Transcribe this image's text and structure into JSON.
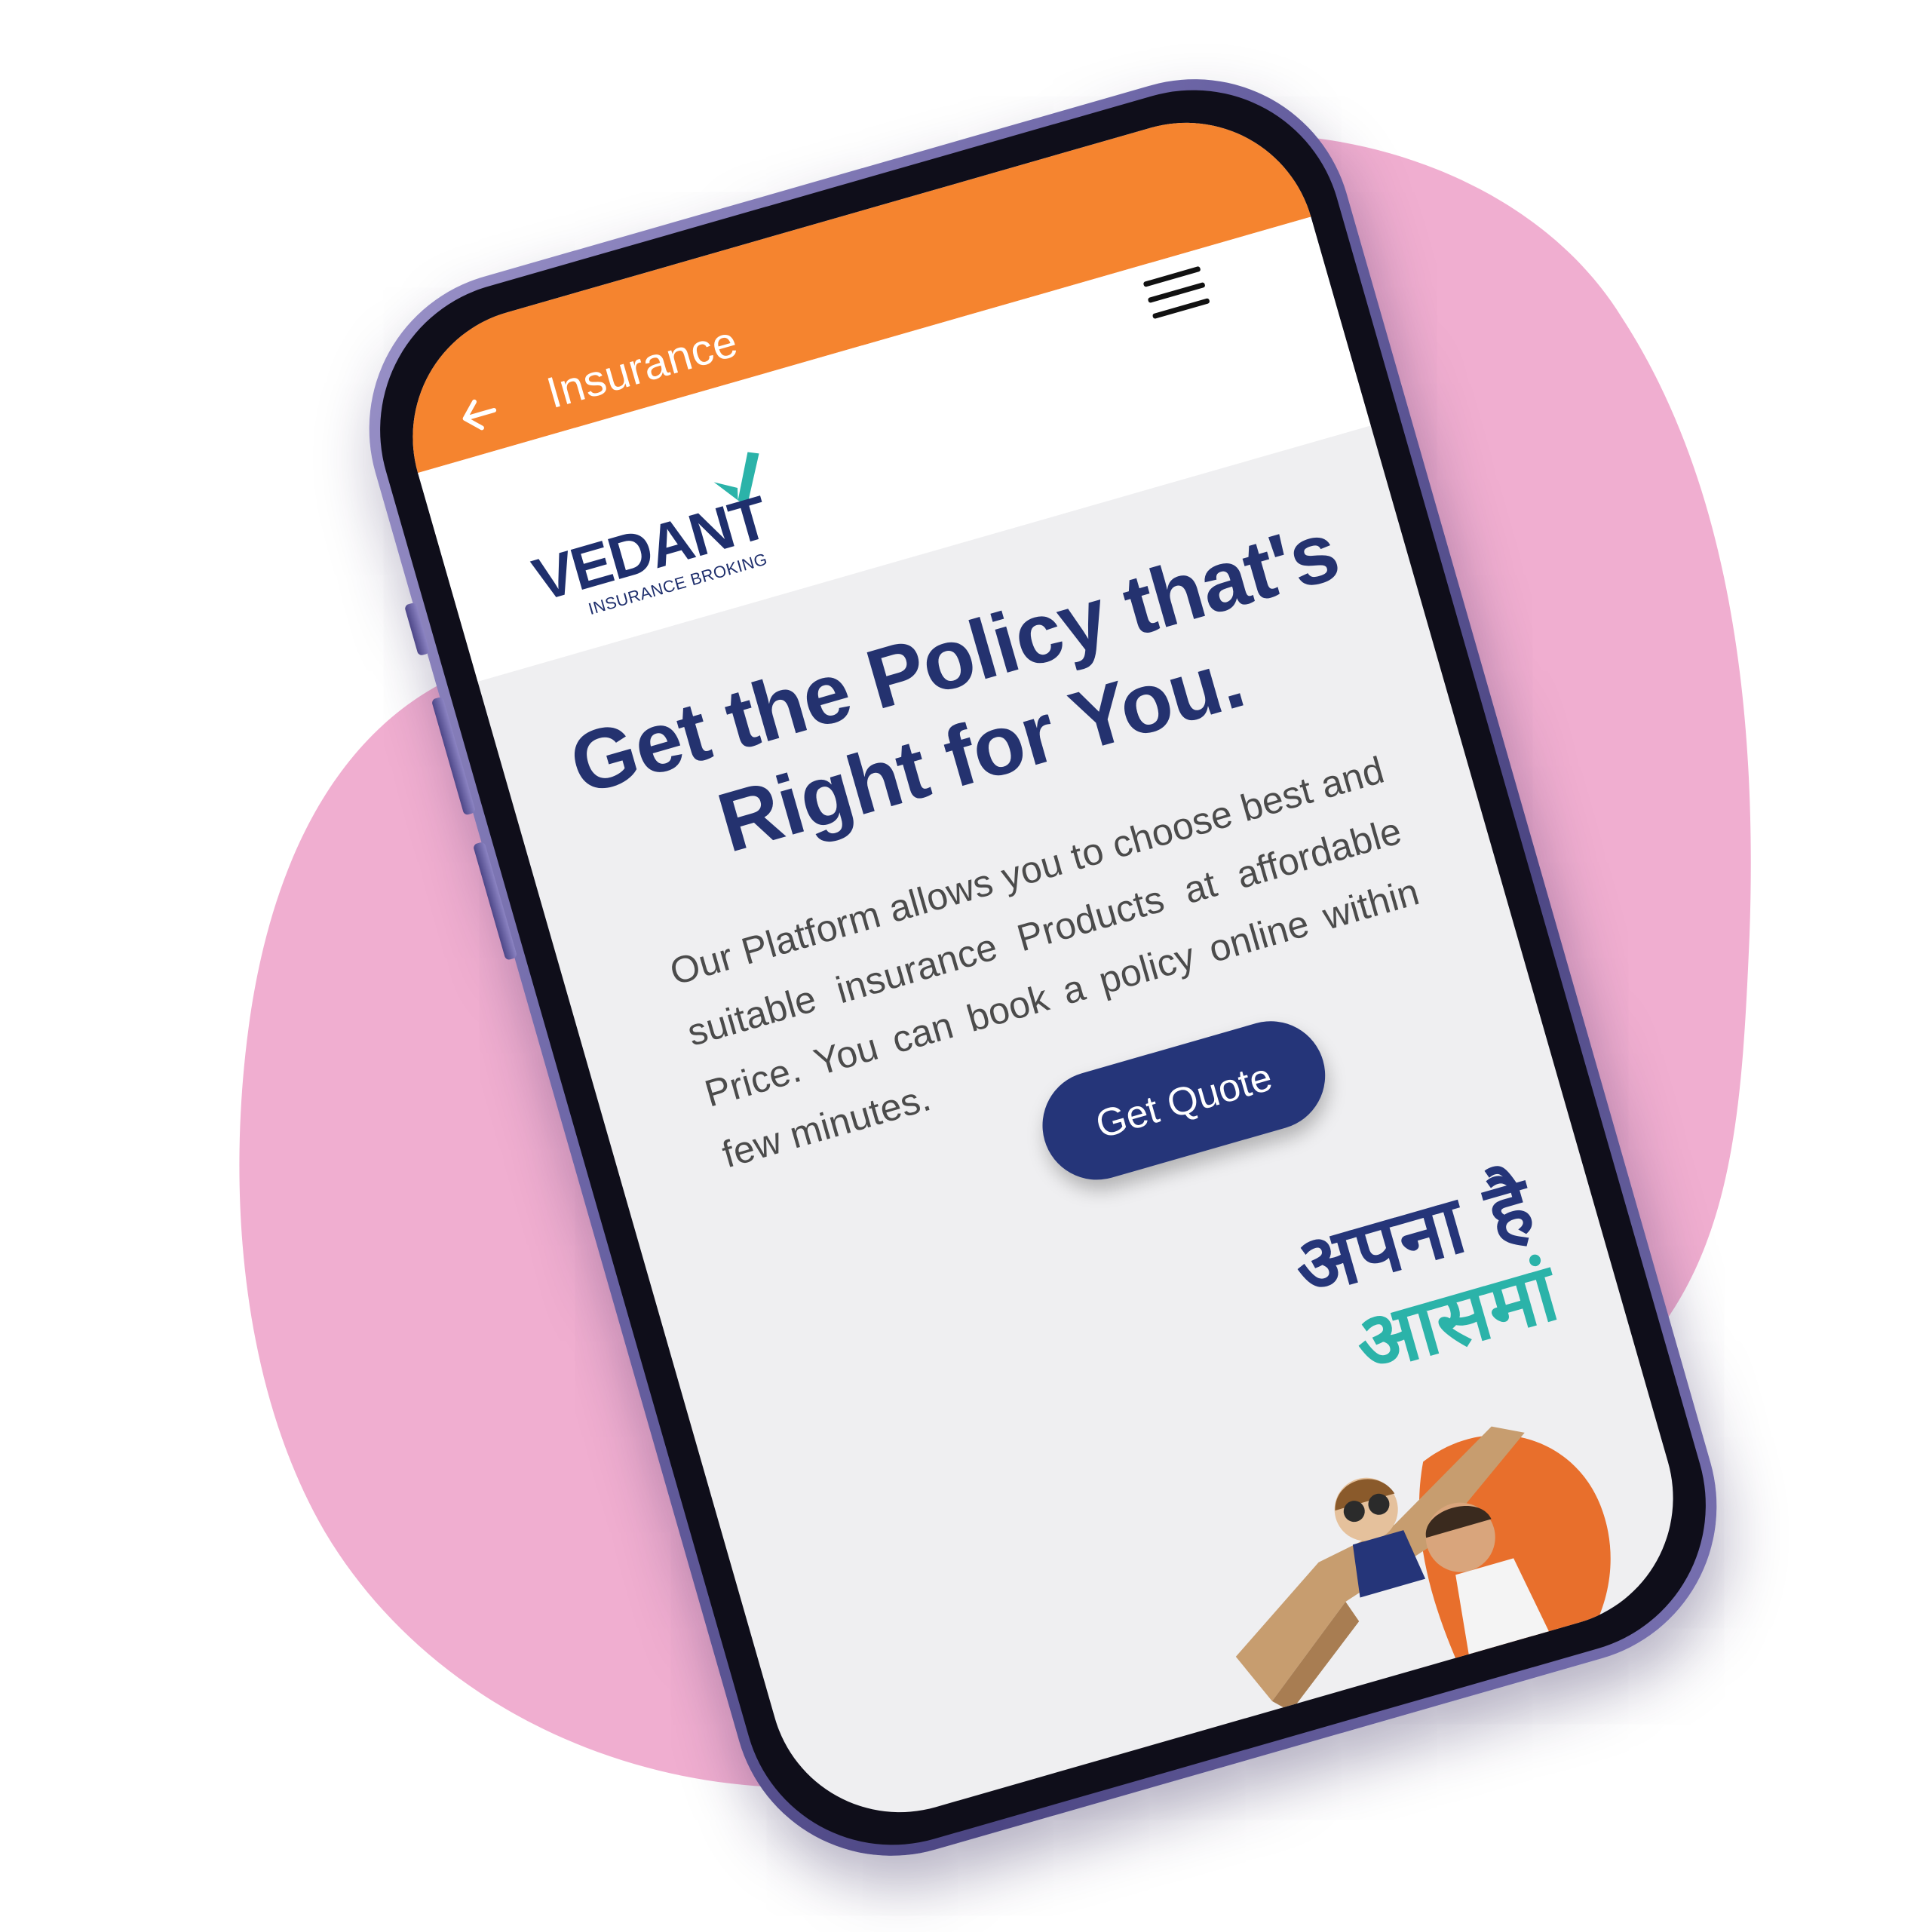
{
  "appbar": {
    "title": "Insurance",
    "back_icon": "arrow-left-icon",
    "color": "#f5842f"
  },
  "navbar": {
    "menu_icon": "hamburger-menu-icon"
  },
  "logo": {
    "name": "VEDANT",
    "subtitle": "INSURANCE BROKING",
    "mark_color": "#2bb3a9",
    "text_color": "#1f2f6d"
  },
  "hero": {
    "title": "Get the Policy that's Right for You.",
    "description": "Our Platform allows you to choose best and suitable insurance Products at affordable Price. You can book a policy online within few minutes.",
    "cta_label": "Get Quote",
    "title_color": "#24326f",
    "cta_color": "#253579"
  },
  "tagline": {
    "line1": "अपना है",
    "line2": "आसमां",
    "line1_color": "#253579",
    "line2_color": "#2bb3a9"
  },
  "background": {
    "blob_color": "#f0aed0"
  }
}
